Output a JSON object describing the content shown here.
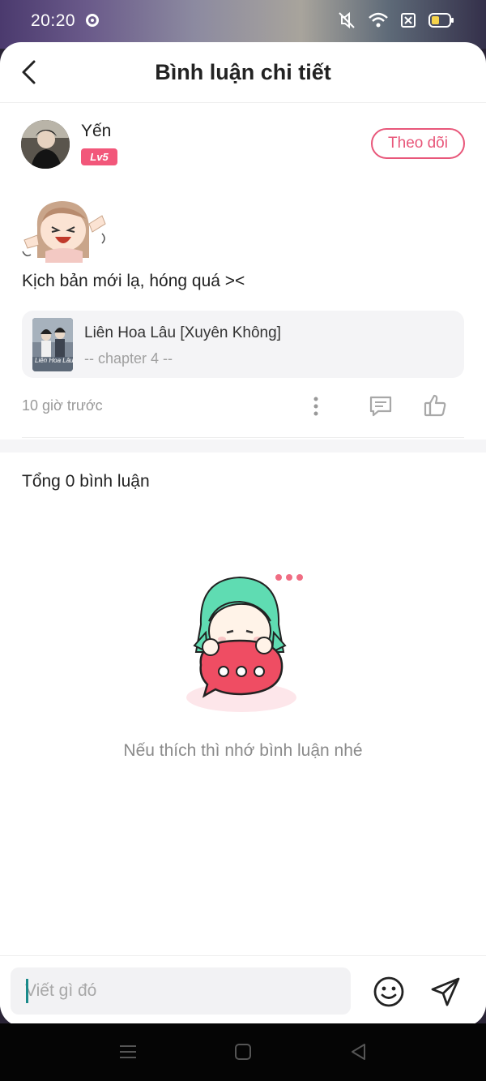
{
  "status_bar": {
    "time": "20:20"
  },
  "header": {
    "title": "Bình luận chi tiết"
  },
  "author": {
    "name": "Yến",
    "level": "Lv5"
  },
  "follow_button": {
    "label": "Theo dõi"
  },
  "comment": {
    "text": "Kịch bản mới lạ, hóng quá ><"
  },
  "book": {
    "title": "Liên Hoa Lâu [Xuyên Không]",
    "chapter": "-- chapter 4 --",
    "cover_text": "Liên Hoa Lâu"
  },
  "meta": {
    "timestamp": "10 giờ trước"
  },
  "replies": {
    "total_label": "Tổng 0 bình luận",
    "empty_hint": "Nếu thích thì nhớ bình luận nhé"
  },
  "input": {
    "placeholder": "Viết gì đó",
    "value": ""
  },
  "colors": {
    "accent": "#e8577a",
    "badge": "#f2577a",
    "caret": "#1a8a8a"
  }
}
